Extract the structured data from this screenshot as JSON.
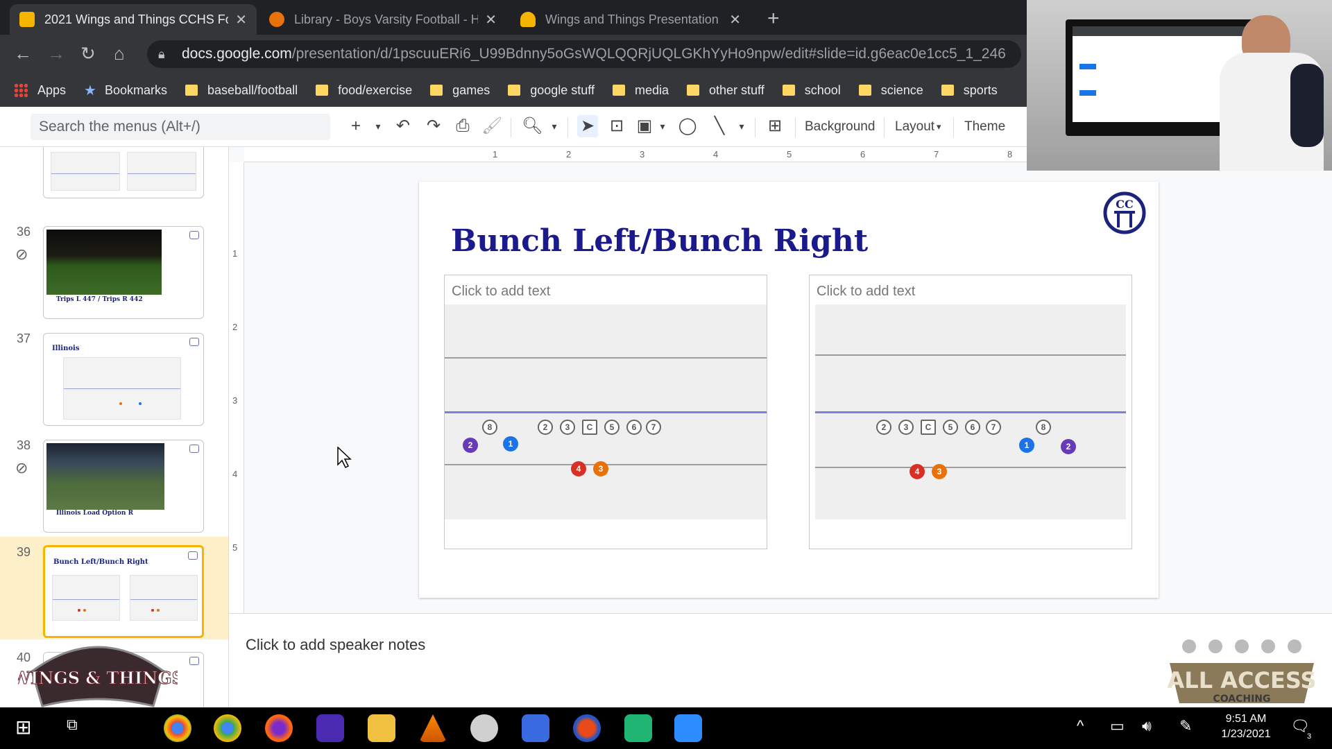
{
  "browser": {
    "tabs": [
      {
        "title": "2021 Wings and Things CCHS Fo",
        "color": "#f4b400",
        "active": true
      },
      {
        "title": "Library - Boys Varsity Football - H",
        "color": "#e8710a",
        "active": false
      },
      {
        "title": "Wings and Things Presentation -",
        "color": "#f4b400",
        "active": false
      }
    ],
    "new_tab": "+",
    "close": "✕",
    "url_host": "docs.google.com",
    "url_path": "/presentation/d/1pscuuERi6_U99Bdnny5oGsWQLQQRjUQLGKhYyHo9npw/edit#slide=id.g6eac0e1cc5_1_246",
    "bookmarks": [
      "Apps",
      "Bookmarks",
      "baseball/football",
      "food/exercise",
      "games",
      "google stuff",
      "media",
      "other stuff",
      "school",
      "science",
      "sports"
    ]
  },
  "toolbar": {
    "search_placeholder": "Search the menus (Alt+/)",
    "background": "Background",
    "layout": "Layout",
    "theme": "Theme"
  },
  "ruler": {
    "h": [
      "1",
      "2",
      "3",
      "4",
      "5",
      "6",
      "7",
      "8"
    ],
    "v": [
      "1",
      "2",
      "3",
      "4",
      "5"
    ]
  },
  "filmstrip": {
    "slides": [
      {
        "num": "36",
        "caption": "Trips L 447 / Trips R 442"
      },
      {
        "num": "37",
        "caption": "Illinois"
      },
      {
        "num": "38",
        "caption": "Illinois Load Option R"
      },
      {
        "num": "39",
        "caption": "Bunch Left/Bunch Right"
      },
      {
        "num": "40",
        "caption": ""
      }
    ]
  },
  "slide": {
    "title": "Bunch Left/Bunch Right",
    "left_placeholder": "Click to add text",
    "right_placeholder": "Click to add text",
    "left_line": [
      "2",
      "3",
      "C",
      "5",
      "6",
      "7"
    ],
    "left_te": "8",
    "right_line": [
      "2",
      "3",
      "C",
      "5",
      "6",
      "7"
    ],
    "right_te": "8",
    "backs": {
      "qb": "4",
      "rb": "3",
      "wr1": "1",
      "wr2": "2"
    },
    "colors": {
      "qb": "#d93025",
      "rb": "#e8710a",
      "wr1": "#1a73e8",
      "wr2": "#673ab7"
    }
  },
  "notes": {
    "placeholder": "Click to add speaker notes"
  },
  "overlay": {
    "brand_bottom_left": "WINGS & THINGS",
    "brand_bottom_right": "ALL ACCESS",
    "brand_sub": "COACHING"
  },
  "taskbar": {
    "time": "9:51 AM",
    "date": "1/23/2021",
    "notif": "3"
  }
}
